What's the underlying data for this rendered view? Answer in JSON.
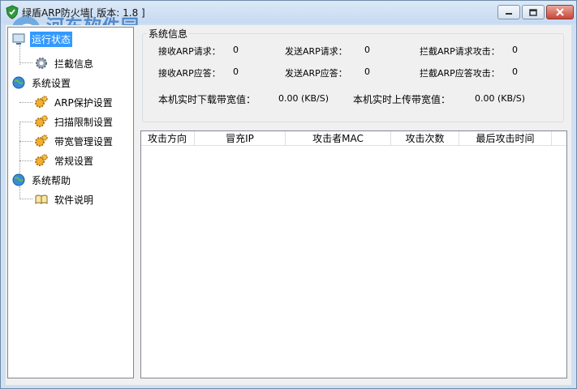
{
  "window": {
    "title": "绿盾ARP防火墙[ 版本: 1.8 ]",
    "accent_color": "#3399ff",
    "titlebar_color": "#cfe0f3",
    "close_color": "#c8463a"
  },
  "watermark": {
    "text": "河东软件园",
    "url": "www.pc0359.cn"
  },
  "sidebar": {
    "items": [
      {
        "label": "运行状态",
        "icon": "monitor-icon",
        "level": 0,
        "selected": true
      },
      {
        "label": "拦截信息",
        "icon": "gear-icon",
        "level": 1
      },
      {
        "label": "系统设置",
        "icon": "globe-icon",
        "level": 0
      },
      {
        "label": "ARP保护设置",
        "icon": "cogs-icon",
        "level": 1
      },
      {
        "label": "扫描限制设置",
        "icon": "cogs-icon",
        "level": 1
      },
      {
        "label": "带宽管理设置",
        "icon": "cogs-icon",
        "level": 1
      },
      {
        "label": "常规设置",
        "icon": "cogs-icon",
        "level": 1
      },
      {
        "label": "系统帮助",
        "icon": "globe-icon",
        "level": 0
      },
      {
        "label": "软件说明",
        "icon": "book-icon",
        "level": 1
      }
    ]
  },
  "system_info": {
    "title": "系统信息",
    "rows": [
      [
        {
          "label": "接收ARP请求：",
          "value": "0"
        },
        {
          "label": "发送ARP请求：",
          "value": "0"
        },
        {
          "label": "拦截ARP请求攻击：",
          "value": "0"
        }
      ],
      [
        {
          "label": "接收ARP应答：",
          "value": "0"
        },
        {
          "label": "发送ARP应答：",
          "value": "0"
        },
        {
          "label": "拦截ARP应答攻击：",
          "value": "0"
        }
      ]
    ],
    "download_label": "本机实时下载带宽值：",
    "download_value": "0.00 (KB/S)",
    "upload_label": "本机实时上传带宽值：",
    "upload_value": "0.00 (KB/S)"
  },
  "attack_table": {
    "columns": [
      "攻击方向",
      "冒充IP",
      "攻击者MAC",
      "攻击次数",
      "最后攻击时间"
    ],
    "rows": []
  }
}
